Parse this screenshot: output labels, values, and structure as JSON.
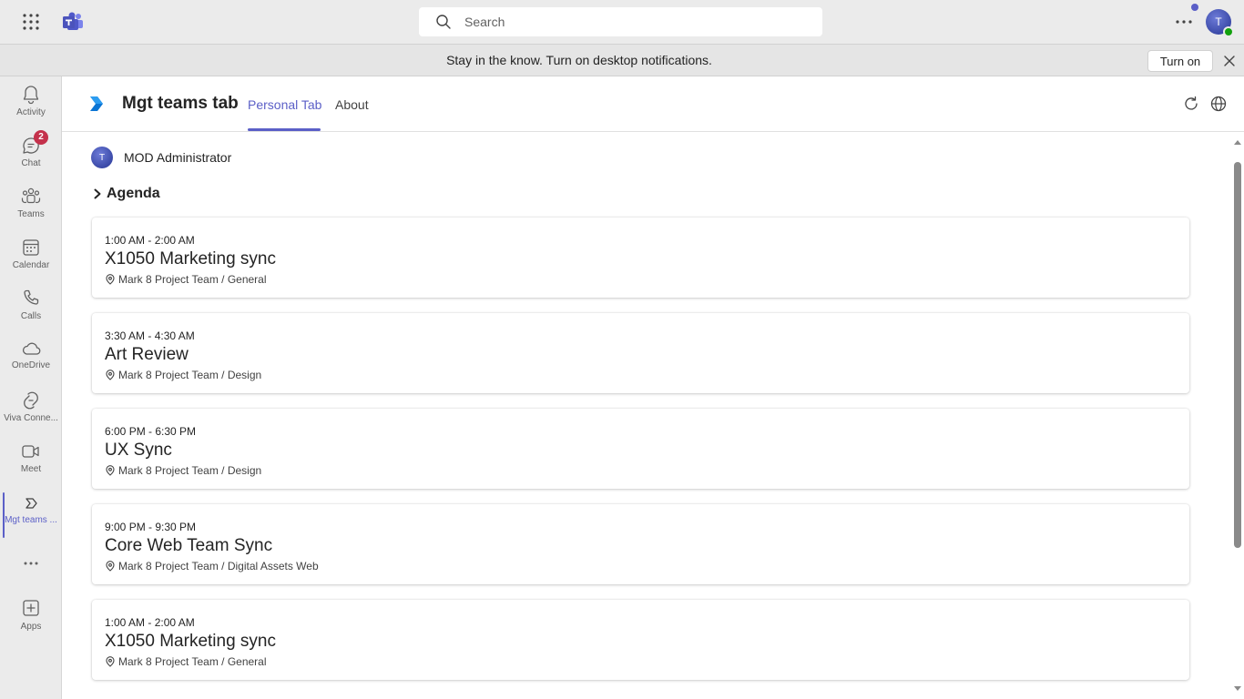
{
  "topbar": {
    "search_placeholder": "Search",
    "avatar_initial": "T"
  },
  "banner": {
    "text": "Stay in the know. Turn on desktop notifications.",
    "button_label": "Turn on"
  },
  "rail": {
    "items": [
      {
        "label": "Activity",
        "icon": "bell-icon"
      },
      {
        "label": "Chat",
        "icon": "chat-icon",
        "badge": "2"
      },
      {
        "label": "Teams",
        "icon": "teams-icon"
      },
      {
        "label": "Calendar",
        "icon": "calendar-icon"
      },
      {
        "label": "Calls",
        "icon": "phone-icon"
      },
      {
        "label": "OneDrive",
        "icon": "cloud-icon"
      },
      {
        "label": "Viva Conne...",
        "icon": "viva-connections-icon"
      },
      {
        "label": "Meet",
        "icon": "video-icon"
      },
      {
        "label": "Mgt teams ...",
        "icon": "mgt-app-icon",
        "active": true
      },
      {
        "label": "",
        "icon": "more-icon"
      },
      {
        "label": "Apps",
        "icon": "add-app-icon"
      }
    ]
  },
  "app": {
    "title": "Mgt teams tab",
    "tabs": [
      {
        "label": "Personal Tab",
        "active": true
      },
      {
        "label": "About",
        "active": false
      }
    ]
  },
  "person": {
    "name": "MOD Administrator",
    "initial": "T"
  },
  "agenda": {
    "title": "Agenda",
    "events": [
      {
        "time": "1:00 AM - 2:00 AM",
        "subject": "X1050 Marketing sync",
        "location": "Mark 8 Project Team / General"
      },
      {
        "time": "3:30 AM - 4:30 AM",
        "subject": "Art Review",
        "location": "Mark 8 Project Team / Design"
      },
      {
        "time": "6:00 PM - 6:30 PM",
        "subject": "UX Sync",
        "location": "Mark 8 Project Team / Design"
      },
      {
        "time": "9:00 PM - 9:30 PM",
        "subject": "Core Web Team Sync",
        "location": "Mark 8 Project Team / Digital Assets Web"
      },
      {
        "time": "1:00 AM - 2:00 AM",
        "subject": "X1050 Marketing sync",
        "location": "Mark 8 Project Team / General"
      }
    ]
  },
  "colors": {
    "accent": "#5b5fc7",
    "badge": "#c4314b",
    "presence": "#13a10e"
  }
}
